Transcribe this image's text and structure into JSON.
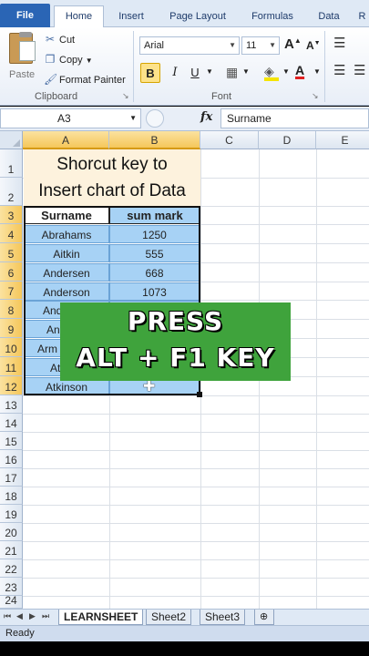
{
  "tabs": [
    "File",
    "Home",
    "Insert",
    "Page Layout",
    "Formulas",
    "Data",
    "R"
  ],
  "clipboard": {
    "paste": "Paste",
    "cut": "Cut",
    "copy": "Copy",
    "format_painter": "Format Painter",
    "label": "Clipboard"
  },
  "font": {
    "name": "Arial",
    "size": "11",
    "bold": "B",
    "italic": "I",
    "underline": "U",
    "grow": "A",
    "shrink": "A",
    "color_letter": "A",
    "label": "Font"
  },
  "formula_bar": {
    "name_box": "A3",
    "fx": "fx",
    "value": "Surname"
  },
  "columns": [
    "A",
    "B",
    "C",
    "D",
    "E"
  ],
  "rows": [
    "1",
    "2",
    "3",
    "4",
    "5",
    "6",
    "7",
    "8",
    "9",
    "10",
    "11",
    "12",
    "13",
    "14",
    "15",
    "16",
    "17",
    "18",
    "19",
    "20",
    "21",
    "22",
    "23",
    "24"
  ],
  "title_lines": [
    "Shorcut key to",
    "Insert chart of Data"
  ],
  "table": {
    "headers": [
      "Surname",
      "sum mark"
    ],
    "rows": [
      [
        "Abrahams",
        "1250"
      ],
      [
        "Aitkin",
        "555"
      ],
      [
        "Andersen",
        "668"
      ],
      [
        "Anderson",
        "1073"
      ],
      [
        "And",
        ""
      ],
      [
        "An",
        ""
      ],
      [
        "Arm",
        ""
      ],
      [
        "At",
        ""
      ],
      [
        "Atkinson",
        ""
      ]
    ]
  },
  "overlay": {
    "line1": "PRESS",
    "line2": "ALT + F1 KEY"
  },
  "sheets": [
    "LEARNSHEET",
    "Sheet2",
    "Sheet3"
  ],
  "status": "Ready",
  "colors": {
    "file_tab": "#2a65b5",
    "selection_fill": "#a7d2f5",
    "title_fill": "#fdf2dd",
    "overlay": "#3fa33c",
    "header_highlight": "#f5c75a"
  }
}
